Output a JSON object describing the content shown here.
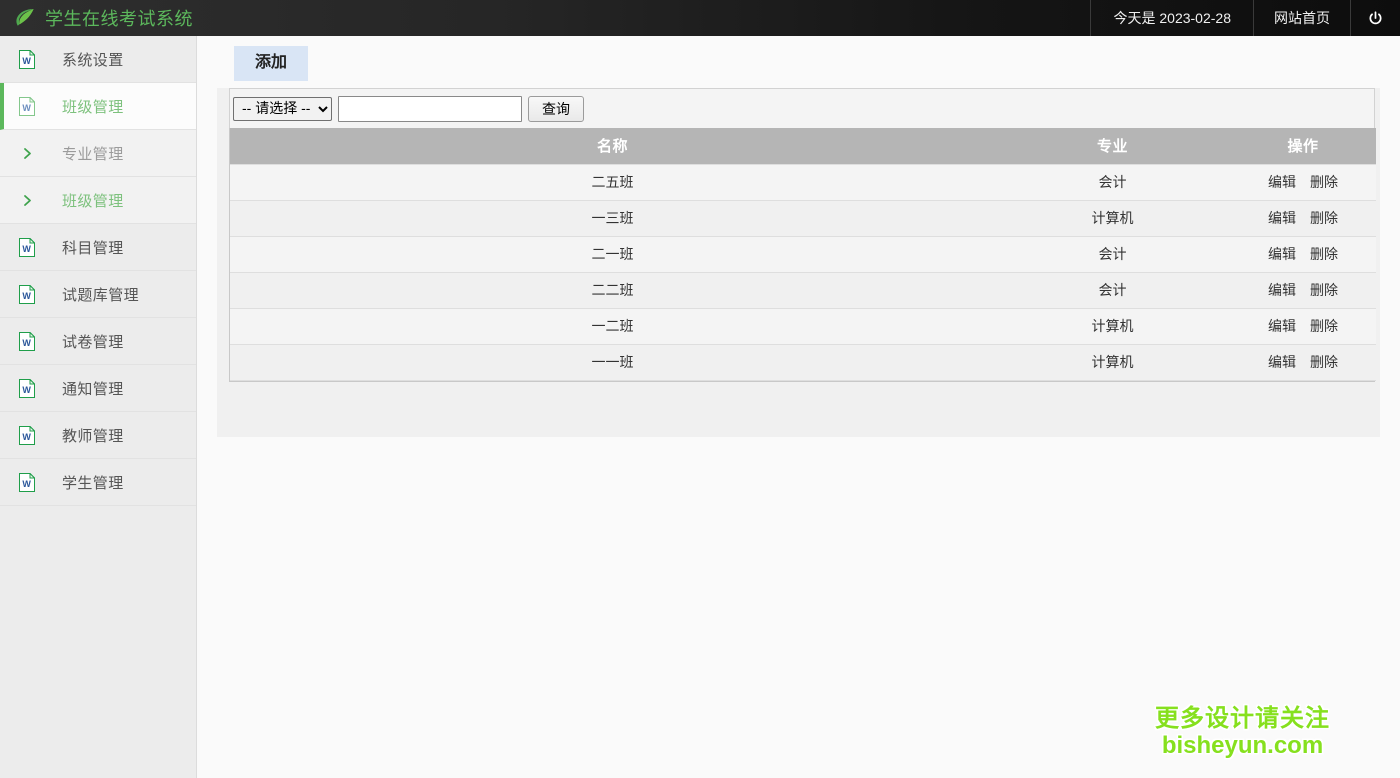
{
  "header": {
    "logo_icon": "leaf-icon",
    "title": "学生在线考试系统",
    "date_label": "今天是 2023-02-28",
    "home_label": "网站首页",
    "power_icon": "power-icon",
    "brand_color": "#5cb85c"
  },
  "sidebar": {
    "items": [
      {
        "label": "系统设置",
        "icon": "word-document-icon",
        "state": "normal",
        "indent": 0
      },
      {
        "label": "班级管理",
        "icon": "word-document-icon",
        "state": "active",
        "indent": 0
      },
      {
        "label": "专业管理",
        "icon": "chevron-right-icon",
        "state": "sub",
        "indent": 1
      },
      {
        "label": "班级管理",
        "icon": "chevron-right-icon",
        "state": "sub-active",
        "indent": 1
      },
      {
        "label": "科目管理",
        "icon": "word-document-icon",
        "state": "normal",
        "indent": 0
      },
      {
        "label": "试题库管理",
        "icon": "word-document-icon",
        "state": "normal",
        "indent": 0
      },
      {
        "label": "试卷管理",
        "icon": "word-document-icon",
        "state": "normal",
        "indent": 0
      },
      {
        "label": "通知管理",
        "icon": "word-document-icon",
        "state": "normal",
        "indent": 0
      },
      {
        "label": "教师管理",
        "icon": "word-document-icon",
        "state": "normal",
        "indent": 0
      },
      {
        "label": "学生管理",
        "icon": "word-document-icon",
        "state": "normal",
        "indent": 0
      }
    ],
    "active_color": "#7dc17d",
    "active_border_color": "#5cb85c"
  },
  "main": {
    "tab_add_label": "添加",
    "tab_add_bg": "#d9e5f5",
    "filter": {
      "select_value": "-- 请选择 --",
      "select_options": [
        "-- 请选择 --"
      ],
      "search_value": "",
      "search_placeholder": "",
      "query_label": "查询"
    },
    "table": {
      "columns": [
        "名称",
        "专业",
        "操作"
      ],
      "rows": [
        {
          "name": "二五班",
          "major": "会计",
          "edit": "编辑",
          "delete": "删除"
        },
        {
          "name": "一三班",
          "major": "计算机",
          "edit": "编辑",
          "delete": "删除"
        },
        {
          "name": "二一班",
          "major": "会计",
          "edit": "编辑",
          "delete": "删除"
        },
        {
          "name": "二二班",
          "major": "会计",
          "edit": "编辑",
          "delete": "删除"
        },
        {
          "name": "一二班",
          "major": "计算机",
          "edit": "编辑",
          "delete": "删除"
        },
        {
          "name": "一一班",
          "major": "计算机",
          "edit": "编辑",
          "delete": "删除"
        }
      ],
      "header_bg": "#b5b5b5"
    }
  },
  "watermark": {
    "line1": "更多设计请关注",
    "line2": "bisheyun.com",
    "color": "#86e01e"
  }
}
